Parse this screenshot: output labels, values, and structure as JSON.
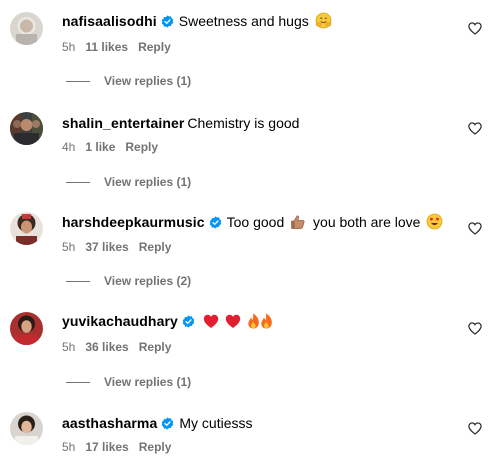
{
  "comments": [
    {
      "username": "nafisaalisodhi",
      "verified": true,
      "text": "Sweetness and hugs",
      "emojis": [
        "hugging-face"
      ],
      "time": "5h",
      "likes": "11 likes",
      "reply": "Reply",
      "view_replies": "View replies (1)"
    },
    {
      "username": "shalin_entertainer",
      "verified": false,
      "text": "Chemistry is good",
      "emojis": [],
      "time": "4h",
      "likes": "1 like",
      "reply": "Reply",
      "view_replies": "View replies (1)"
    },
    {
      "username": "harshdeepkaurmusic",
      "verified": true,
      "text": "Too good",
      "text2": "you both are love",
      "emojis": [
        "thumbs-up",
        "heart-eyes"
      ],
      "time": "5h",
      "likes": "37 likes",
      "reply": "Reply",
      "view_replies": "View replies (2)"
    },
    {
      "username": "yuvikachaudhary",
      "verified": true,
      "text": "",
      "emojis": [
        "red-heart",
        "red-heart",
        "fire",
        "fire"
      ],
      "time": "5h",
      "likes": "36 likes",
      "reply": "Reply",
      "view_replies": "View replies (1)"
    },
    {
      "username": "aasthasharma",
      "verified": true,
      "text": "My cutiesss",
      "emojis": [],
      "time": "5h",
      "likes": "17 likes",
      "reply": "Reply"
    }
  ],
  "colors": {
    "verified": "#0095f6",
    "secondary_text": "#737373",
    "primary_text": "#000000"
  }
}
